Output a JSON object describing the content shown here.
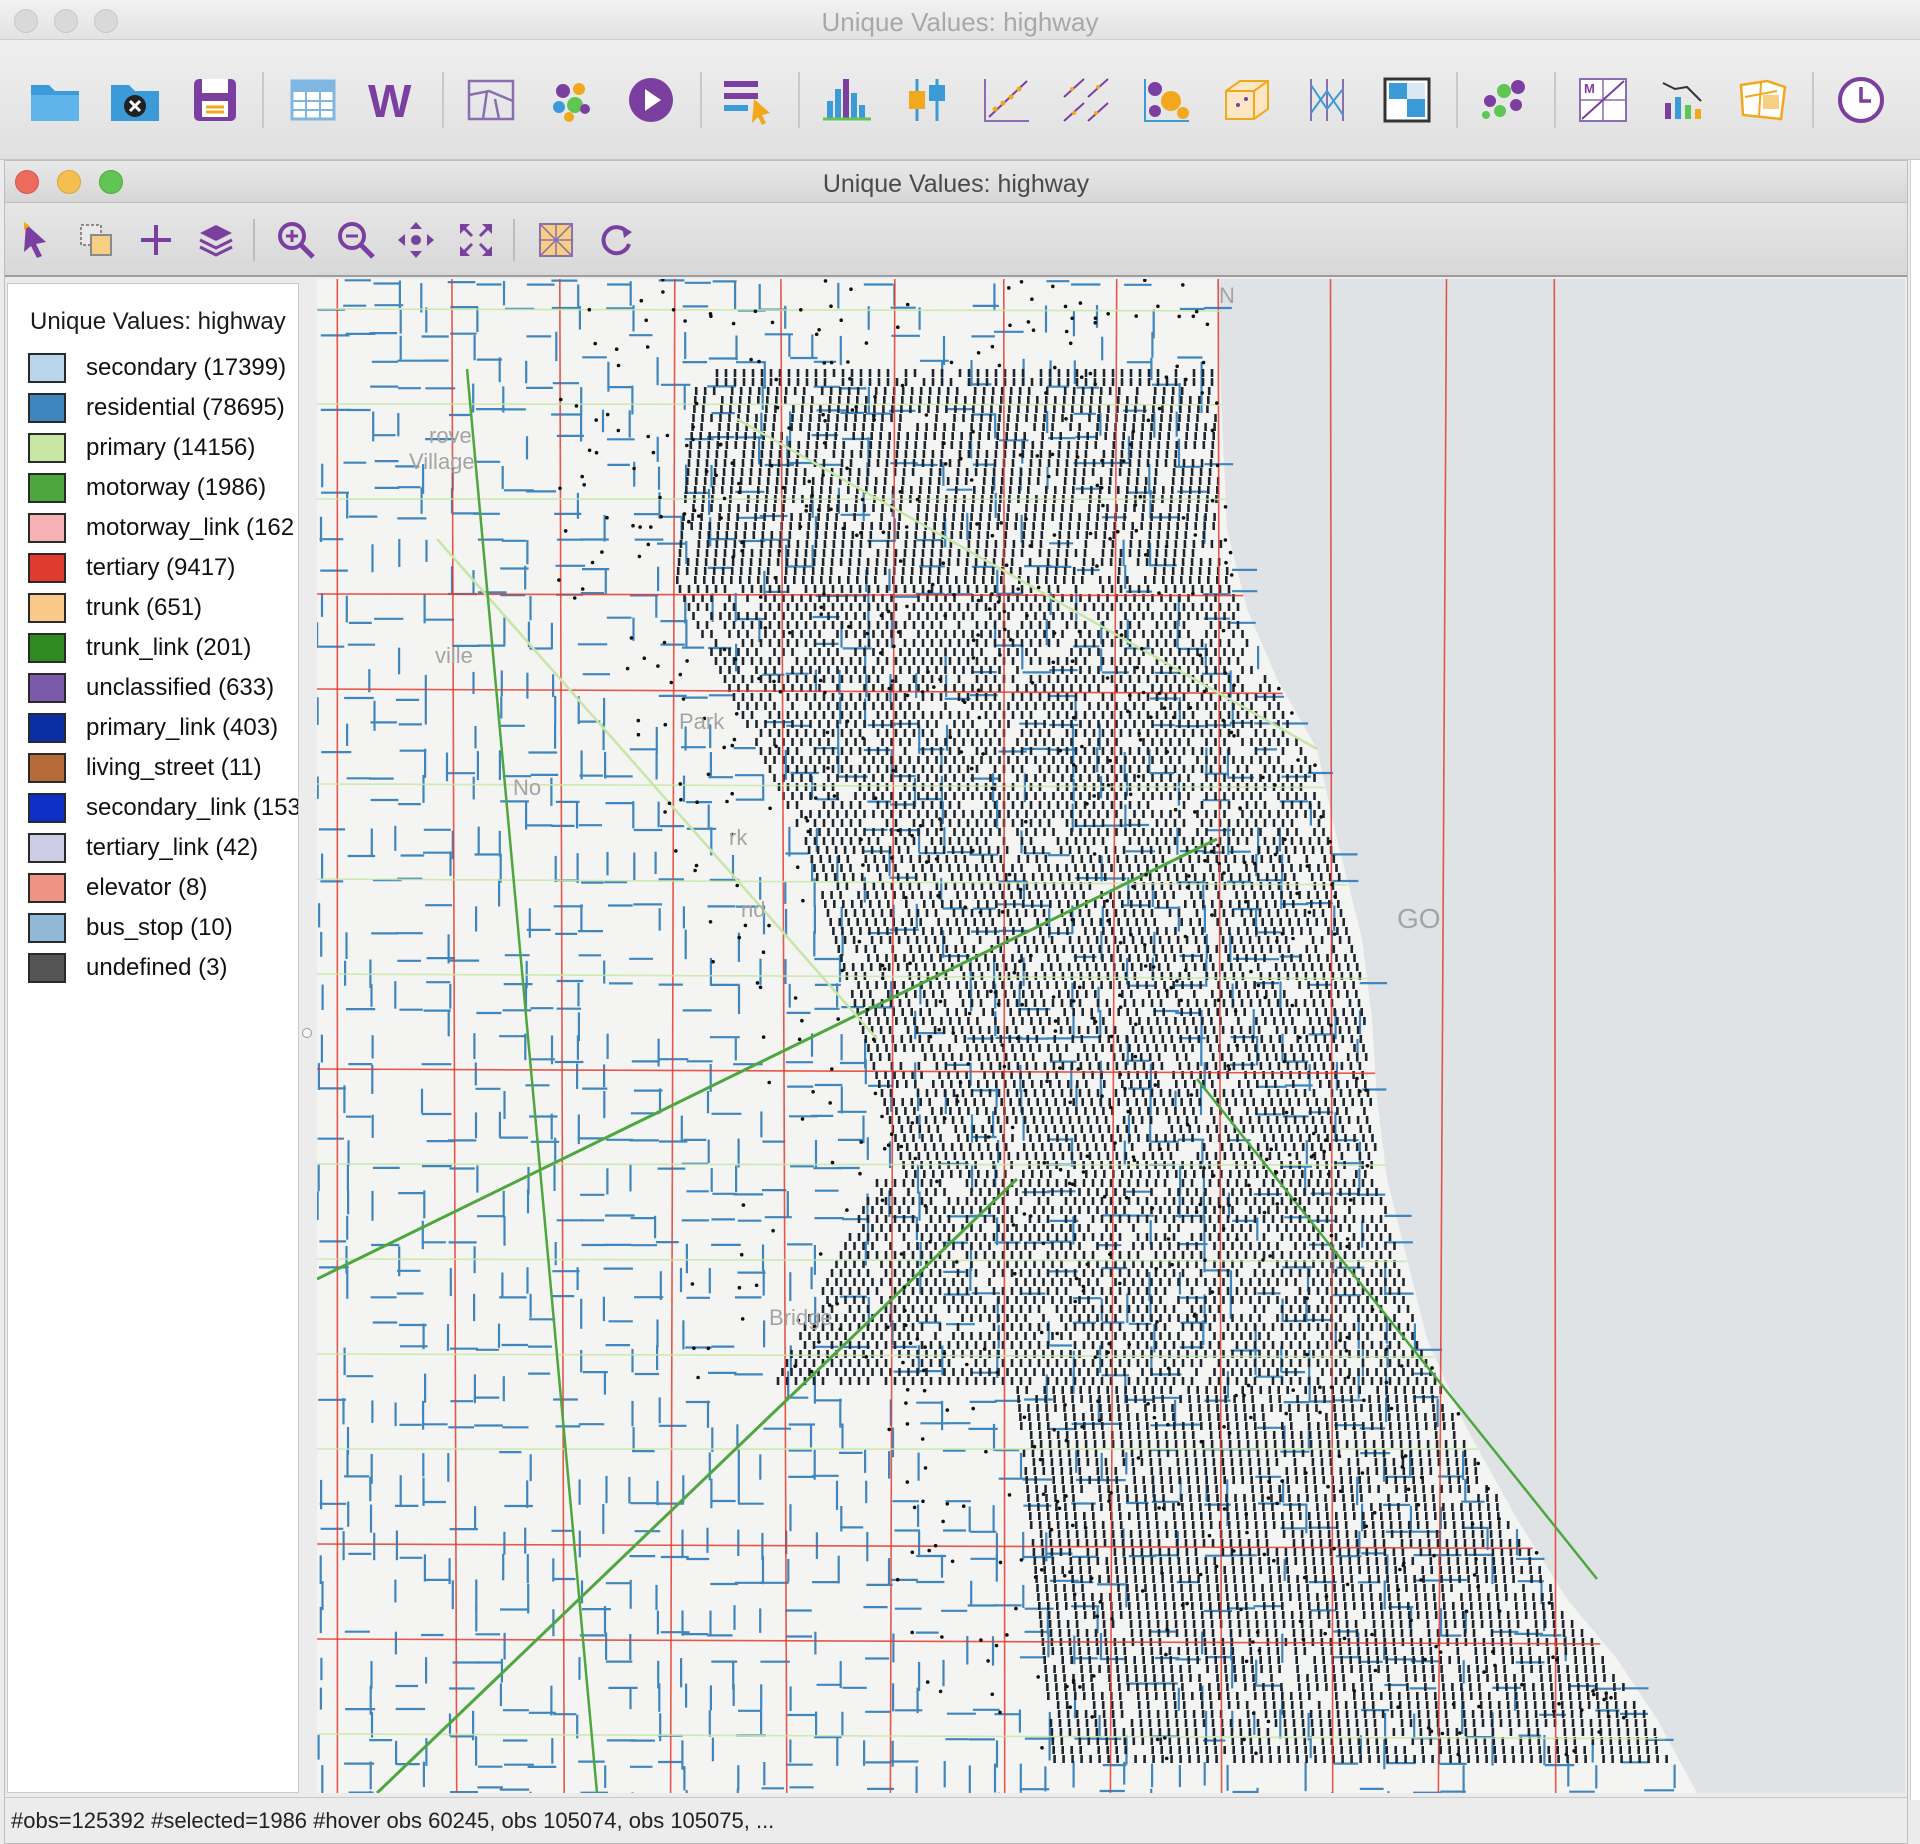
{
  "outer_window": {
    "title": "Unique Values: highway"
  },
  "main_toolbar": {
    "icons": [
      "open-folder-icon",
      "close-project-icon",
      "save-icon",
      "table-icon",
      "weights-icon",
      "map-icon",
      "cluster-map-icon",
      "play-icon",
      "select-tool-icon",
      "histogram-icon",
      "box-plot-icon",
      "scatter-plot-icon",
      "scatter-matrix-icon",
      "bubble-chart-icon",
      "3d-scatter-icon",
      "parallel-coordinates-icon",
      "conditional-plot-icon",
      "cluster-icon",
      "moran-scatter-icon",
      "averages-chart-icon",
      "cartogram-icon",
      "time-icon"
    ]
  },
  "map_window": {
    "title": "Unique Values: highway",
    "toolbar_icons": [
      "select-arrow-icon",
      "selection-shape-icon",
      "add-icon",
      "layers-icon",
      "zoom-in-icon",
      "zoom-out-icon",
      "pan-icon",
      "full-extent-icon",
      "basemap-icon",
      "refresh-icon"
    ]
  },
  "legend": {
    "title": "Unique Values: highway",
    "items": [
      {
        "label": "secondary (17399)",
        "color": "#b9d5ea"
      },
      {
        "label": "residential (78695)",
        "color": "#3f86bf"
      },
      {
        "label": "primary (14156)",
        "color": "#c7e6a6"
      },
      {
        "label": "motorway (1986)",
        "color": "#4ea63f"
      },
      {
        "label": "motorway_link (162",
        "color": "#f5b1b3"
      },
      {
        "label": "tertiary (9417)",
        "color": "#e03b2f"
      },
      {
        "label": "trunk (651)",
        "color": "#f9c98a"
      },
      {
        "label": "trunk_link (201)",
        "color": "#2f8a22"
      },
      {
        "label": "unclassified (633)",
        "color": "#7b5aa8"
      },
      {
        "label": "primary_link (403)",
        "color": "#0c2ea5"
      },
      {
        "label": "living_street (11)",
        "color": "#b56a3a"
      },
      {
        "label": "secondary_link (153",
        "color": "#0d2fc8"
      },
      {
        "label": "tertiary_link (42)",
        "color": "#cecbe4"
      },
      {
        "label": "elevator (8)",
        "color": "#ef9384"
      },
      {
        "label": "bus_stop (10)",
        "color": "#93b7d6"
      },
      {
        "label": "undefined (3)",
        "color": "#555555"
      }
    ]
  },
  "map": {
    "place_labels": [
      "rove",
      "Village",
      "ville",
      "Park",
      "No",
      "rk",
      "nd",
      "GO",
      "Bridge",
      "N"
    ],
    "colors": {
      "lake": "#dfe3e6",
      "land": "#f4f4f2",
      "residential": "#3f86bf",
      "selected": "#1e2630",
      "tertiary": "#e03b2f",
      "motorway": "#4ea63f",
      "primary": "#c7e6a6"
    }
  },
  "status_bar": {
    "text": "#obs=125392 #selected=1986  #hover obs 60245, obs 105074, obs 105075, ..."
  }
}
